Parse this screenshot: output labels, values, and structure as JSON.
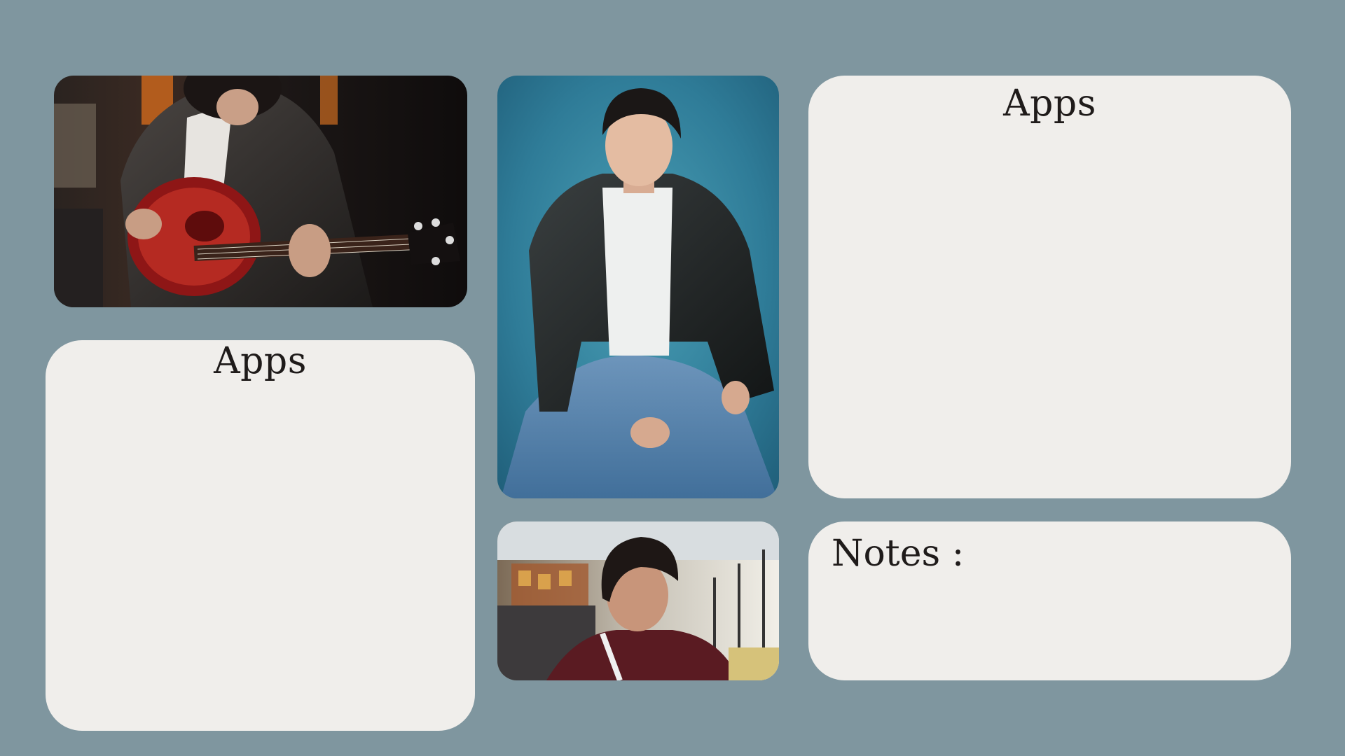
{
  "background_color": "#7f969f",
  "card_color": "#f0eeeb",
  "left_apps": {
    "title": "Apps"
  },
  "right_apps": {
    "title": "Apps"
  },
  "notes": {
    "title": "Notes :"
  },
  "photos": {
    "guitar": {
      "subject": "man-playing-guitar-photo"
    },
    "portrait": {
      "subject": "man-seated-leather-jacket-photo"
    },
    "store": {
      "subject": "man-in-store-photo"
    }
  }
}
